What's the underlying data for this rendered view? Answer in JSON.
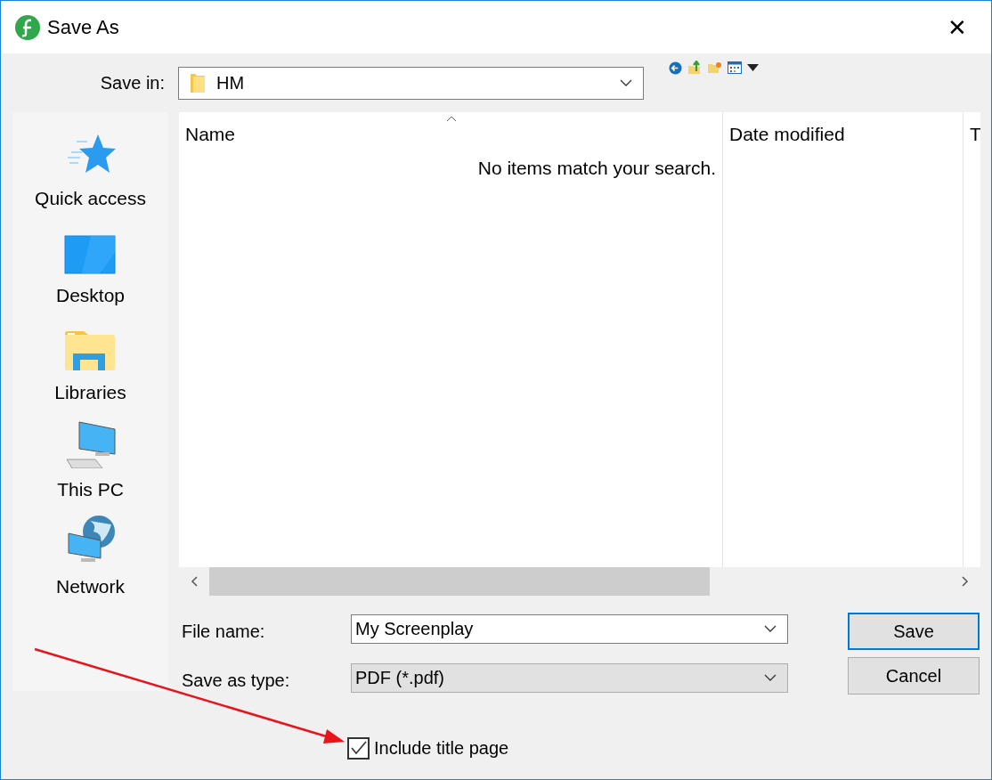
{
  "window": {
    "title": "Save As",
    "close": "✕"
  },
  "save_in": {
    "label": "Save in:",
    "value": "HM"
  },
  "sidebar": {
    "items": [
      {
        "kind": "star",
        "label": "Quick access"
      },
      {
        "kind": "desktop",
        "label": "Desktop"
      },
      {
        "kind": "libraries",
        "label": "Libraries"
      },
      {
        "kind": "pc",
        "label": "This PC"
      },
      {
        "kind": "network",
        "label": "Network"
      }
    ]
  },
  "file_list": {
    "columns": [
      "Name",
      "Date modified",
      "T"
    ],
    "empty_message": "No items match your search."
  },
  "file_name": {
    "label": "File name:",
    "value": "My Screenplay"
  },
  "save_as_type": {
    "label": "Save as type:",
    "value": "PDF (*.pdf)"
  },
  "buttons": [
    {
      "label": "Save",
      "default": true
    },
    {
      "label": "Cancel",
      "default": false
    }
  ],
  "include_title_page": {
    "label": "Include title page",
    "checked": true
  }
}
